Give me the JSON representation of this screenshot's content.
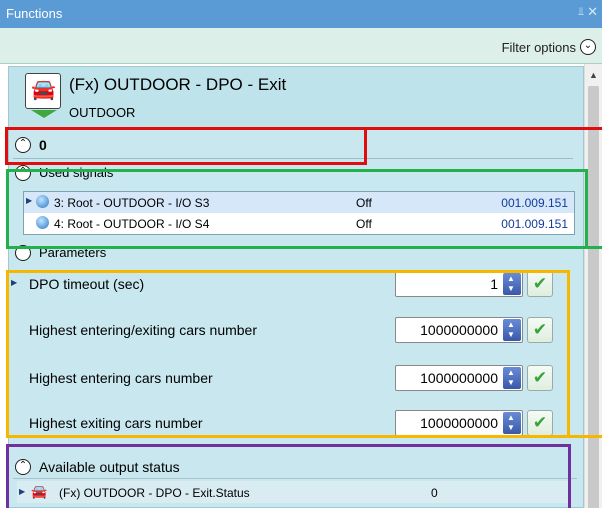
{
  "window": {
    "title": "Functions"
  },
  "filter": {
    "label": "Filter options"
  },
  "function": {
    "name": "(Fx) OUTDOOR - DPO - Exit",
    "location": "OUTDOOR",
    "value": "0"
  },
  "used_signals": {
    "label": "Used signals",
    "rows": [
      {
        "name": "3: Root - OUTDOOR - I/O S3",
        "state": "Off",
        "address": "001.009.151"
      },
      {
        "name": "4: Root - OUTDOOR - I/O S4",
        "state": "Off",
        "address": "001.009.151"
      }
    ]
  },
  "parameters": {
    "label": "Parameters",
    "items": [
      {
        "label": "DPO timeout (sec)",
        "value": "1"
      },
      {
        "label": "Highest entering/exiting cars number",
        "value": "1000000000"
      },
      {
        "label": "Highest entering cars number",
        "value": "1000000000"
      },
      {
        "label": "Highest exiting cars number",
        "value": "1000000000"
      }
    ]
  },
  "output_status": {
    "label": "Available output status",
    "rows": [
      {
        "name": "(Fx) OUTDOOR - DPO - Exit.Status",
        "value": "0"
      }
    ]
  },
  "colors": {
    "titlebar": "#5b9bd5",
    "panel": "#c8e7ee",
    "red": "#e00d0d",
    "green": "#22b14c",
    "yellow": "#f5b700",
    "purple": "#7030a0"
  }
}
